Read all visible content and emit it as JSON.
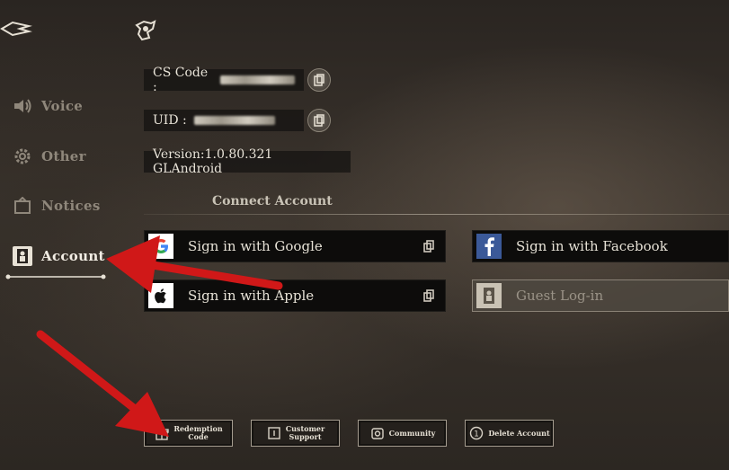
{
  "sidebar": {
    "items": [
      {
        "label": "Voice",
        "icon": "speaker-icon",
        "active": false
      },
      {
        "label": "Other",
        "icon": "gear-icon",
        "active": false
      },
      {
        "label": "Notices",
        "icon": "notice-icon",
        "active": false
      },
      {
        "label": "Account",
        "icon": "account-icon",
        "active": true
      }
    ]
  },
  "info": {
    "cs_code_label": "CS Code :",
    "uid_label": "UID :",
    "version": "Version:1.0.80.321 GLAndroid"
  },
  "connect": {
    "title": "Connect Account",
    "google": "Sign in with Google",
    "apple": "Sign in with Apple",
    "facebook": "Sign in with Facebook",
    "guest": "Guest Log-in"
  },
  "bottom": {
    "redemption": [
      "Redemption",
      "Code"
    ],
    "support": [
      "Customer",
      "Support"
    ],
    "community": "Community",
    "delete": "Delete Account"
  },
  "colors": {
    "annotation_red": "#d01818",
    "facebook_blue": "#3b5998",
    "google_red": "#ea4335",
    "google_blue": "#4285f4",
    "google_yellow": "#fbbc05",
    "google_green": "#34a853"
  }
}
